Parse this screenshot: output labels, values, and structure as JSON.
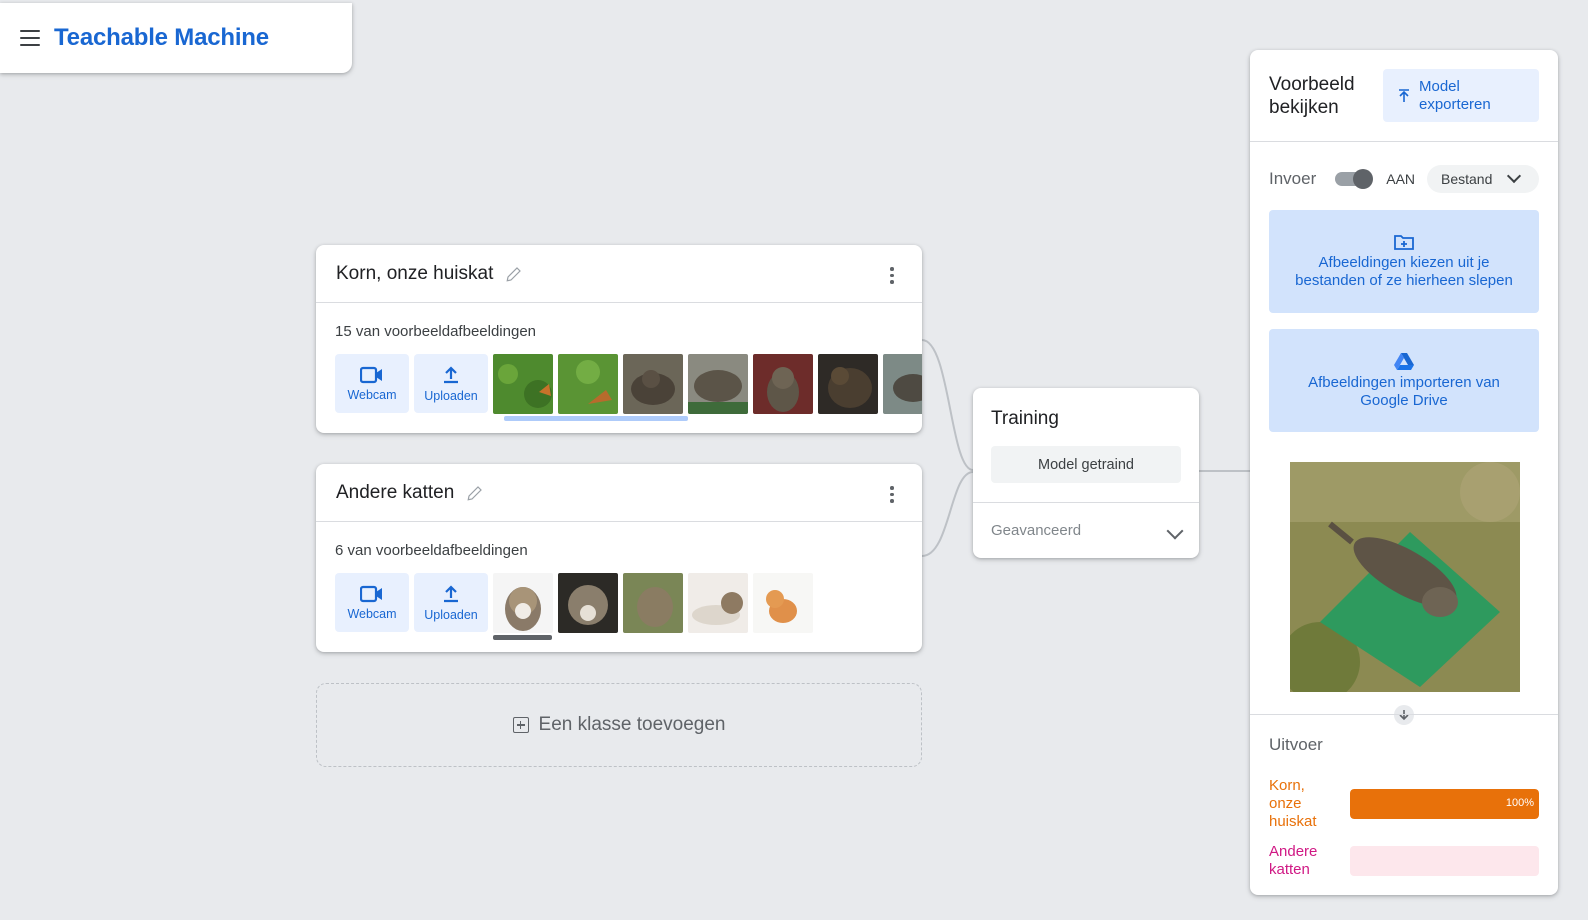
{
  "app": {
    "title": "Teachable Machine"
  },
  "classes": [
    {
      "name": "Korn, onze huiskat",
      "sample_count": "15 van voorbeeldafbeeldingen",
      "webcam_label": "Webcam",
      "upload_label": "Uploaden"
    },
    {
      "name": "Andere katten",
      "sample_count": "6 van voorbeeldafbeeldingen",
      "webcam_label": "Webcam",
      "upload_label": "Uploaden"
    }
  ],
  "add_class": {
    "label": "Een klasse toevoegen"
  },
  "training": {
    "title": "Training",
    "button": "Model getraind",
    "advanced": "Geavanceerd"
  },
  "preview": {
    "title": "Voorbeeld bekijken",
    "export_label": "Model exporteren",
    "input_label": "Invoer",
    "toggle_state": "AAN",
    "source_select": "Bestand",
    "file_drop": "Afbeeldingen kiezen uit je bestanden of ze hierheen slepen",
    "drive_import": "Afbeeldingen importeren van Google Drive",
    "output_title": "Uitvoer",
    "outputs": [
      {
        "label": "Korn, onze huiskat",
        "percent_text": "100%",
        "value": 100,
        "color": "#e8710a",
        "track": "#fce8d6"
      },
      {
        "label": "Andere katten",
        "percent_text": "",
        "value": 0,
        "color": "#d01884",
        "track": "#fde7ec"
      }
    ]
  },
  "colors": {
    "accent": "#1967d2",
    "output_orange": "#e8710a",
    "output_pink": "#d01884"
  }
}
